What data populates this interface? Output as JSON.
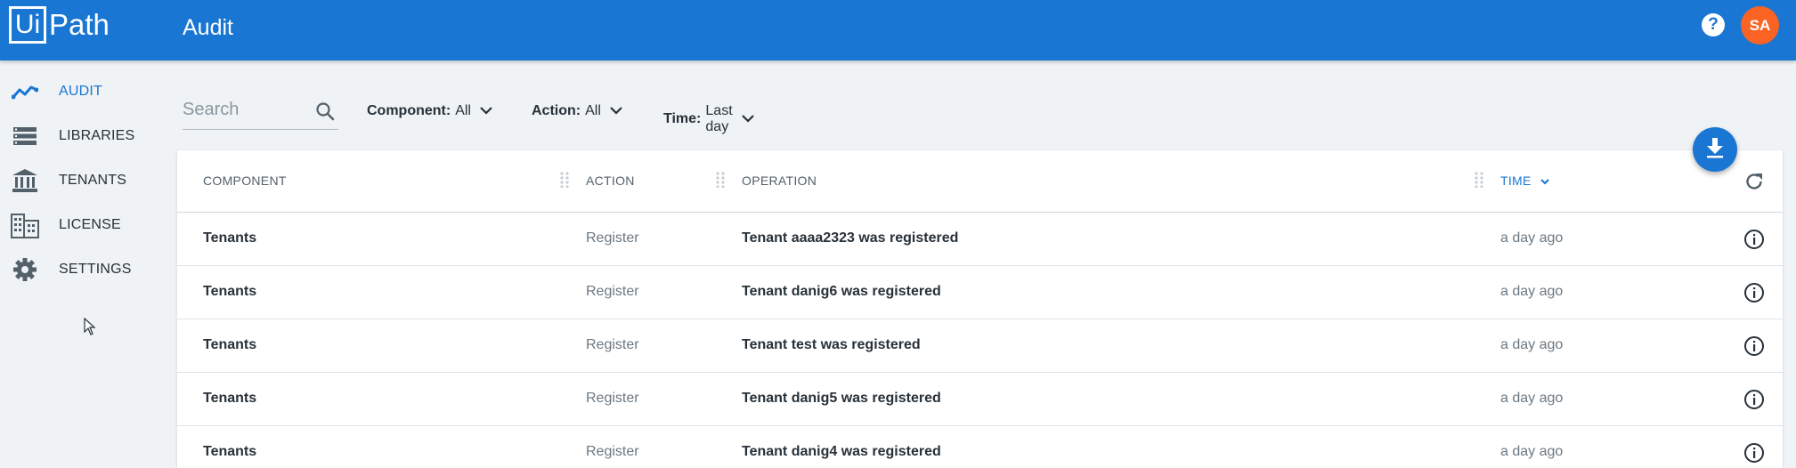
{
  "app": {
    "logo_box": "Ui",
    "logo_rest": "Path",
    "title": "Audit",
    "help_label": "?",
    "user_initials": "SA"
  },
  "sidebar": {
    "items": [
      {
        "label": "AUDIT",
        "icon": "trend-line-icon",
        "active": true
      },
      {
        "label": "LIBRARIES",
        "icon": "list-stack-icon",
        "active": false
      },
      {
        "label": "TENANTS",
        "icon": "bank-building-icon",
        "active": false
      },
      {
        "label": "LICENSE",
        "icon": "city-buildings-icon",
        "active": false
      },
      {
        "label": "SETTINGS",
        "icon": "gear-icon",
        "active": false
      }
    ]
  },
  "filters": {
    "search_placeholder": "Search",
    "component_label": "Component:",
    "component_value": "All",
    "action_label": "Action:",
    "action_value": "All",
    "time_label": "Time:",
    "time_value": "Last day"
  },
  "grid": {
    "columns": [
      "COMPONENT",
      "ACTION",
      "OPERATION",
      "TIME"
    ],
    "sorted_column": "TIME",
    "rows": [
      {
        "component": "Tenants",
        "action": "Register",
        "operation": "Tenant aaaa2323 was registered",
        "time": "a day ago"
      },
      {
        "component": "Tenants",
        "action": "Register",
        "operation": "Tenant danig6 was registered",
        "time": "a day ago"
      },
      {
        "component": "Tenants",
        "action": "Register",
        "operation": "Tenant test was registered",
        "time": "a day ago"
      },
      {
        "component": "Tenants",
        "action": "Register",
        "operation": "Tenant danig5 was registered",
        "time": "a day ago"
      },
      {
        "component": "Tenants",
        "action": "Register",
        "operation": "Tenant danig4 was registered",
        "time": "a day ago"
      }
    ]
  },
  "colors": {
    "accent": "#1976d2",
    "avatar": "#fa6324",
    "background": "#eff3f6"
  }
}
